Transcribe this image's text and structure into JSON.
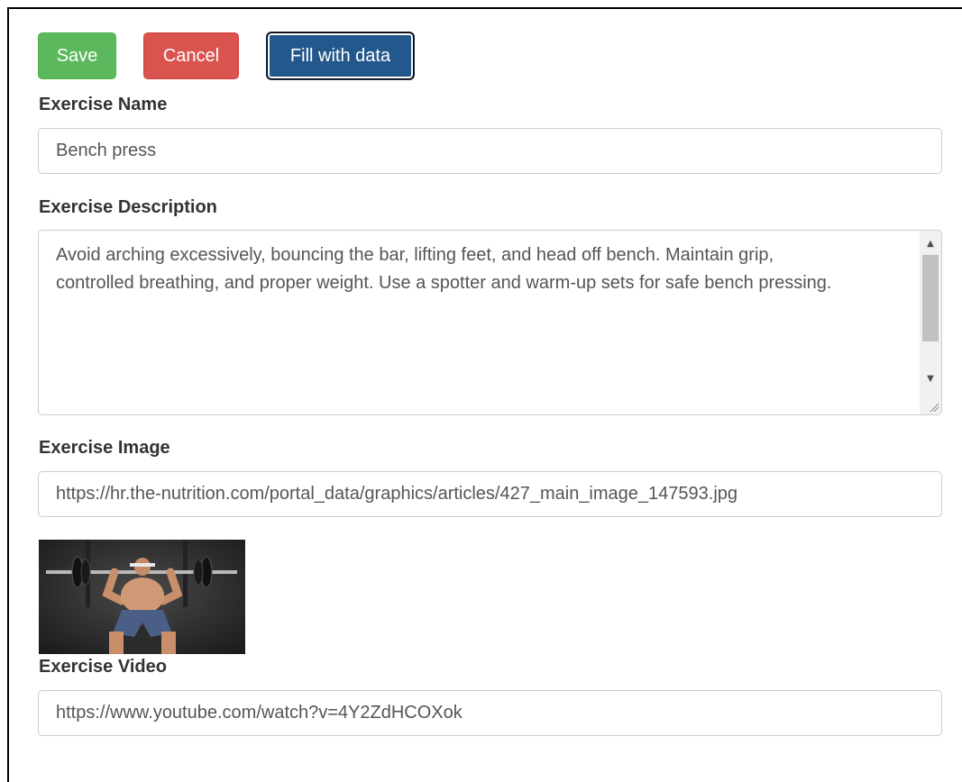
{
  "toolbar": {
    "save_label": "Save",
    "cancel_label": "Cancel",
    "fill_label": "Fill with data"
  },
  "form": {
    "name_label": "Exercise Name",
    "name_value": "Bench press",
    "description_label": "Exercise Description",
    "description_value": "Avoid arching excessively, bouncing the bar, lifting feet, and head off bench. Maintain grip, controlled breathing, and proper weight. Use a spotter and warm-up sets for safe bench pressing.",
    "image_label": "Exercise Image",
    "image_value": "https://hr.the-nutrition.com/portal_data/graphics/articles/427_main_image_147593.jpg",
    "video_label": "Exercise Video",
    "video_value": "https://www.youtube.com/watch?v=4Y2ZdHCOXok"
  },
  "icons": {
    "scroll_up": "scroll-up-arrow-icon",
    "scroll_down": "scroll-down-arrow-icon",
    "resize": "resize-grip-icon"
  },
  "colors": {
    "save": "#5cb85c",
    "cancel": "#d9534f",
    "fill": "#23588c"
  }
}
